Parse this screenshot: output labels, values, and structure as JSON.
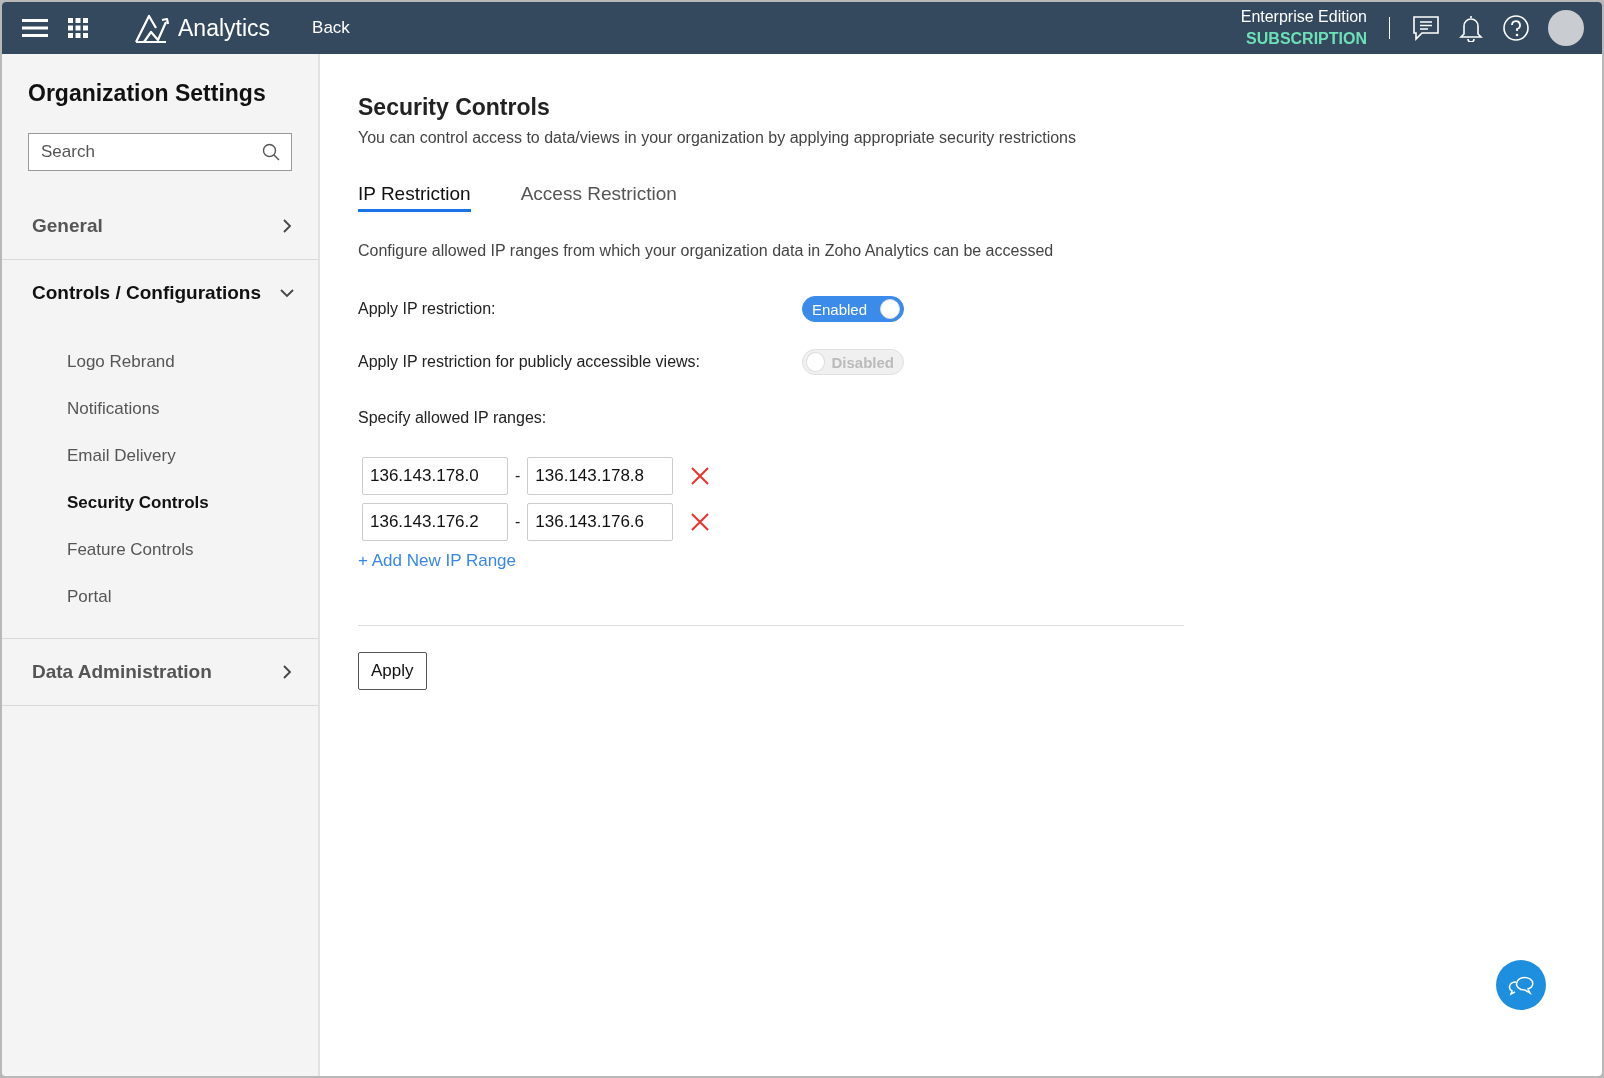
{
  "header": {
    "app_name": "Analytics",
    "back": "Back",
    "edition": "Enterprise Edition",
    "subscription": "SUBSCRIPTION"
  },
  "sidebar": {
    "title": "Organization Settings",
    "search": {
      "placeholder": "Search"
    },
    "groups": [
      {
        "label": "General",
        "expanded": false
      },
      {
        "label": "Controls / Configurations",
        "expanded": true,
        "items": [
          {
            "label": "Logo Rebrand",
            "selected": false
          },
          {
            "label": "Notifications",
            "selected": false
          },
          {
            "label": "Email Delivery",
            "selected": false
          },
          {
            "label": "Security Controls",
            "selected": true
          },
          {
            "label": "Feature Controls",
            "selected": false
          },
          {
            "label": "Portal",
            "selected": false
          }
        ]
      },
      {
        "label": "Data Administration",
        "expanded": false
      }
    ]
  },
  "main": {
    "title": "Security Controls",
    "subtitle": "You can control access to data/views in your organization by applying appropriate security restrictions",
    "tabs": [
      {
        "label": "IP Restriction",
        "selected": true
      },
      {
        "label": "Access Restriction",
        "selected": false
      }
    ],
    "description": "Configure allowed IP ranges from which your organization data in Zoho Analytics can be accessed",
    "settings": [
      {
        "label": "Apply IP restriction:",
        "toggle": "Enabled",
        "on": true
      },
      {
        "label": "Apply IP restriction for publicly accessible views:",
        "toggle": "Disabled",
        "on": false
      }
    ],
    "ranges_label": "Specify allowed IP ranges:",
    "ranges": [
      {
        "from": "136.143.178.0",
        "separator": "-",
        "to": "136.143.178.8"
      },
      {
        "from": "136.143.176.2",
        "separator": "-",
        "to": "136.143.176.6"
      }
    ],
    "add_link": "+ Add New IP Range",
    "apply_button": "Apply"
  }
}
